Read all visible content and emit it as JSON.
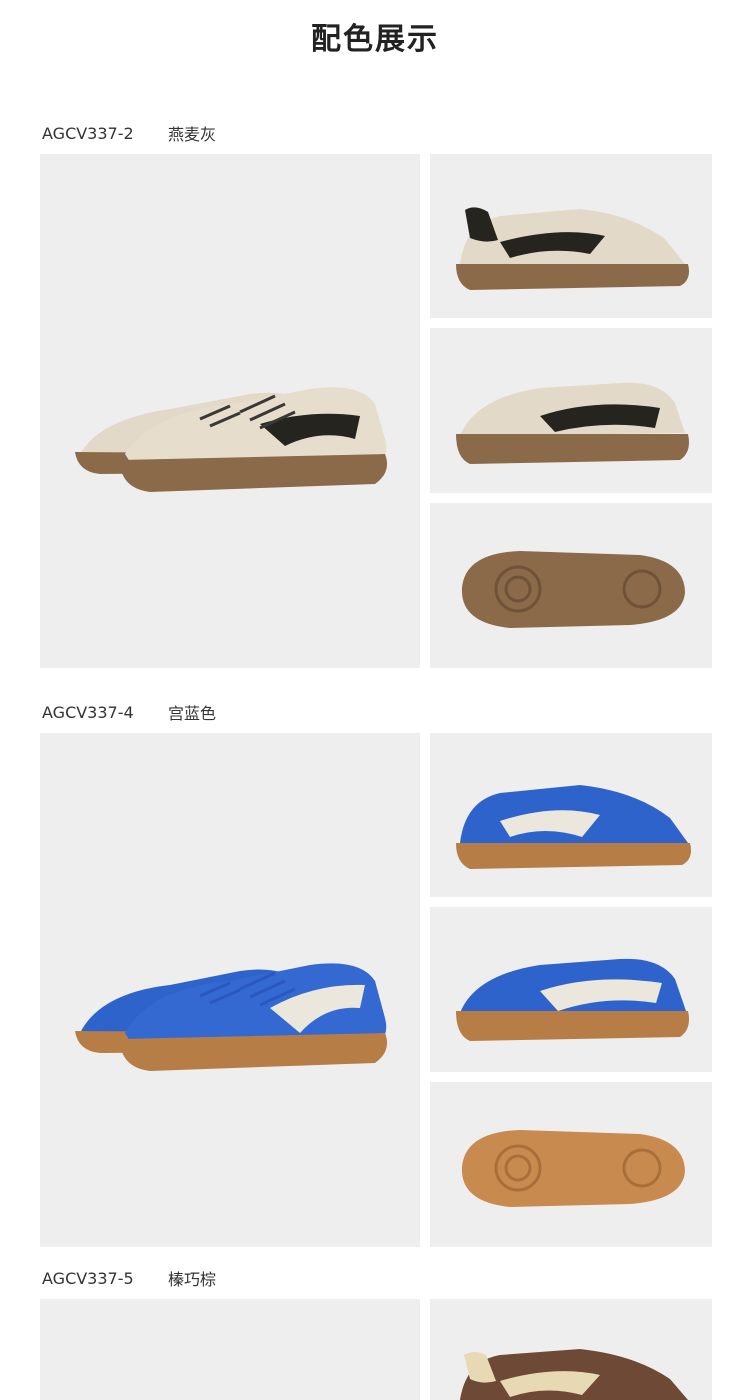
{
  "page": {
    "title": "配色展示"
  },
  "variants": [
    {
      "code": "AGCV337-2",
      "color_name": "燕麦灰",
      "upper_color": "#e3d9c8",
      "stripe_color": "#26241f",
      "sole_color": "#8b6a4a",
      "lace_color": "#3a3835"
    },
    {
      "code": "AGCV337-4",
      "color_name": "宫蓝色",
      "upper_color": "#2f63cc",
      "stripe_color": "#ece7dc",
      "sole_color": "#b77d47",
      "lace_color": "#2b58c0"
    },
    {
      "code": "AGCV337-5",
      "color_name": "榛巧棕",
      "upper_color": "#6e4a36",
      "stripe_color": "#e8d9b5",
      "sole_color": "#a67a4f",
      "lace_color": "#5c3d2c"
    }
  ]
}
